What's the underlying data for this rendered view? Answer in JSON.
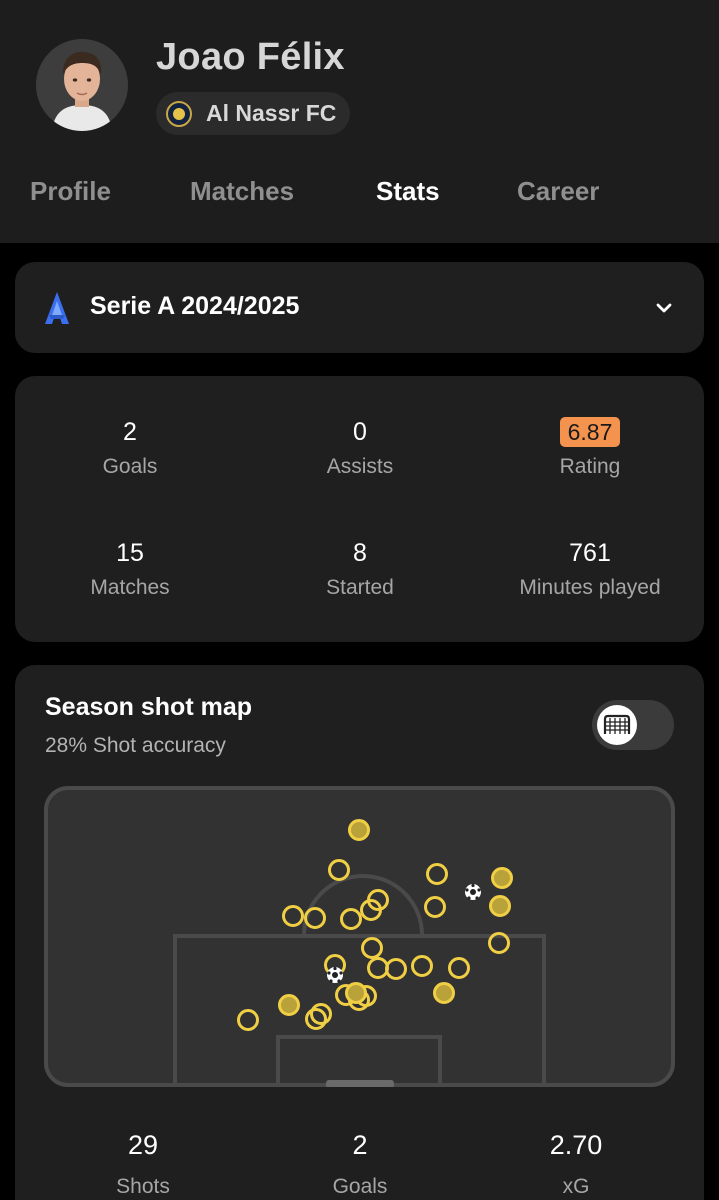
{
  "player": {
    "name": "Joao Félix",
    "team": "Al Nassr FC"
  },
  "tabs": [
    {
      "label": "Profile",
      "active": false
    },
    {
      "label": "Matches",
      "active": false
    },
    {
      "label": "Stats",
      "active": true
    },
    {
      "label": "Career",
      "active": false
    }
  ],
  "league": {
    "name": "Serie A 2024/2025",
    "icon": "serie-a-logo"
  },
  "stats": [
    {
      "value": "2",
      "label": "Goals"
    },
    {
      "value": "0",
      "label": "Assists"
    },
    {
      "value": "6.87",
      "label": "Rating"
    },
    {
      "value": "15",
      "label": "Matches"
    },
    {
      "value": "8",
      "label": "Started"
    },
    {
      "value": "761",
      "label": "Minutes played"
    }
  ],
  "shot_map": {
    "title": "Season shot map",
    "subtitle": "28% Shot accuracy",
    "toggle_icon": "goal-net-icon",
    "summary": [
      {
        "value": "29",
        "label": "Shots"
      },
      {
        "value": "2",
        "label": "Goals"
      },
      {
        "value": "2.70",
        "label": "xG"
      }
    ]
  },
  "colors": {
    "rating_badge": "#f4934d",
    "shot_marker": "#f0cf45",
    "on_target_fill": "#b8a239",
    "header_bg": "#1d1d1d",
    "card_bg": "#1f1f1f"
  }
}
